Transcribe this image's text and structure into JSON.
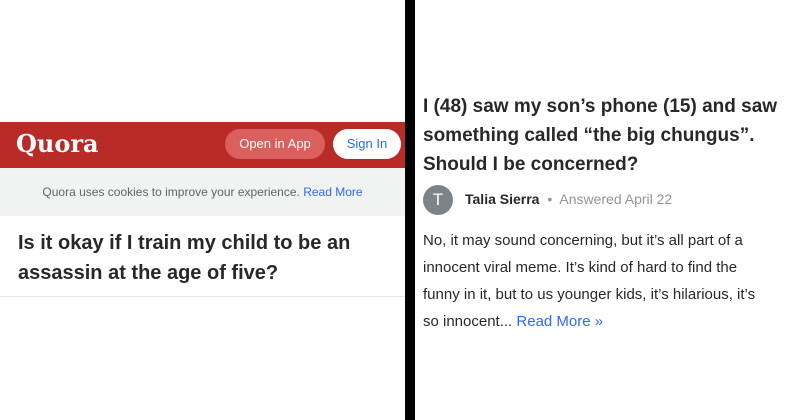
{
  "left": {
    "header": {
      "logo": "Quora",
      "open_in_app": "Open in App",
      "sign_in": "Sign In"
    },
    "cookie_notice": {
      "text": "Quora uses cookies to improve your experience.",
      "link": "Read More"
    },
    "question": "Is it okay if I train my child to be an assassin at the age of five?"
  },
  "right": {
    "question": "I (48) saw my son’s phone (15) and saw something called “the big chungus”. Should I be concerned?",
    "answer": {
      "avatar_letter": "T",
      "author": "Talia Sierra",
      "separator": "•",
      "meta": "Answered April 22",
      "lines": [
        "No, it may sound concerning, but it’s all part of a",
        "innocent viral meme. It’s kind of hard to find the",
        "funny in it, but to us younger kids, it’s hilarious, it’s",
        "so innocent..."
      ],
      "read_more": "Read More »"
    }
  },
  "colors": {
    "quora_red": "#b92b27",
    "link_blue": "#2e69ff",
    "divider": "#000000"
  }
}
